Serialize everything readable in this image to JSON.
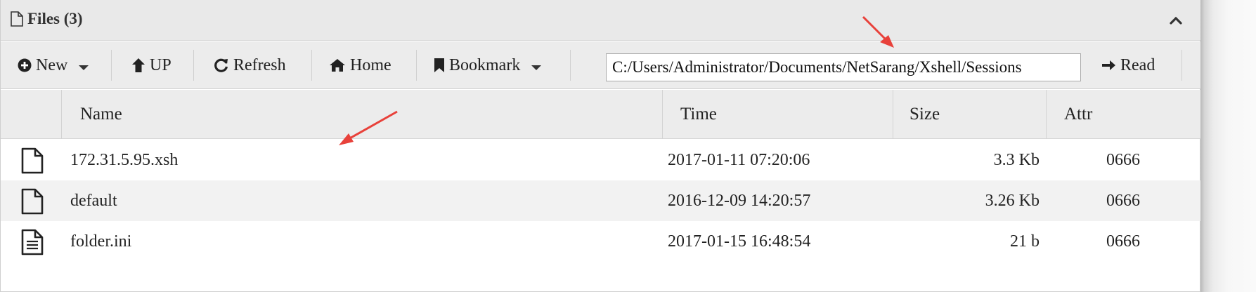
{
  "header": {
    "title": "Files (3)",
    "file_icon": "file-icon",
    "collapse_icon": "chevron-up-icon"
  },
  "toolbar": {
    "new_label": "New",
    "up_label": "UP",
    "refresh_label": "Refresh",
    "home_label": "Home",
    "bookmark_label": "Bookmark",
    "path_value": "C:/Users/Administrator/Documents/NetSarang/Xshell/Sessions",
    "read_label": "Read"
  },
  "columns": {
    "name": "Name",
    "time": "Time",
    "size": "Size",
    "attr": "Attr"
  },
  "files": [
    {
      "icon": "file-icon",
      "name": "172.31.5.95.xsh",
      "time": "2017-01-11 07:20:06",
      "size": "3.3 Kb",
      "attr": "0666"
    },
    {
      "icon": "file-icon",
      "name": "default",
      "time": "2016-12-09 14:20:57",
      "size": "3.26 Kb",
      "attr": "0666"
    },
    {
      "icon": "text-file-icon",
      "name": "folder.ini",
      "time": "2017-01-15 16:48:54",
      "size": "21 b",
      "attr": "0666"
    }
  ],
  "annotations": {
    "arrow_color": "#e8413a"
  },
  "colors": {
    "toolbar_bg": "#ececec",
    "alt_row_bg": "#f2f2f2"
  }
}
